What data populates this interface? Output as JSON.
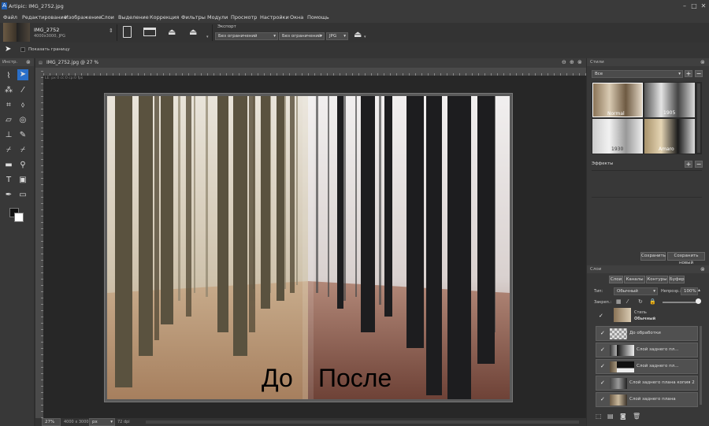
{
  "app_title": "Artipic: IMG_2752.jpg",
  "menu": [
    "Файл",
    "Редактирование",
    "Изображение",
    "Слои",
    "Выделение",
    "Коррекция",
    "Фильтры",
    "Модули",
    "Просмотр",
    "Настройки",
    "Окна",
    "Помощь"
  ],
  "file": {
    "name": "IMG_2752",
    "meta": "4000x3000, JPG"
  },
  "export": {
    "label": "Экспорт",
    "opt1": "Без ограничений",
    "opt2": "Без ограничений",
    "format": "JPG"
  },
  "options": {
    "show_bounds": "Показать границу"
  },
  "tools_panel_title": "Инстр.",
  "document": {
    "tab_title": "IMG_2752.jpg @ 27 %",
    "info": "LE: px 0 cc:0 cp:0 fps"
  },
  "image_text": {
    "before": "До",
    "after": "После"
  },
  "status": {
    "zoom": "27%",
    "size": "4000 x 3000",
    "unit": "px",
    "dpi": "72 dpi"
  },
  "styles_panel": {
    "title": "Стили",
    "filter": "Все",
    "thumbs": [
      "Normal",
      "1905",
      "1930",
      "Amaro"
    ],
    "effects_label": "Эффекты",
    "save": "Сохранить",
    "save_new": "Сохранить новый"
  },
  "layers_panel": {
    "title": "Слои",
    "tabs": [
      "Слои",
      "Каналы",
      "Контуры",
      "Буфер"
    ],
    "type_label": "Тип:",
    "blend": "Обычный",
    "opacity_label": "Непрозр.:",
    "opacity": "100%",
    "lock_label": "Закреп.:",
    "style_row": {
      "name": "Стиль",
      "blend": "Обычный"
    },
    "layers": [
      "До обработки",
      "Слой заднего пл...",
      "Слой заднего пл...",
      "Слой заднего плана копия 2",
      "Слой заднего плана"
    ]
  },
  "colors": {
    "accent": "#2a6fc9",
    "panel": "#383838"
  }
}
